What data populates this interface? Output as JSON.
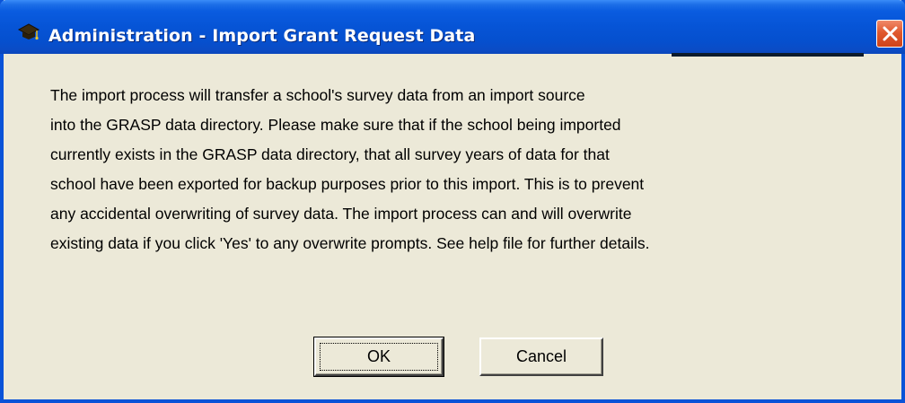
{
  "window": {
    "title": "Administration - Import Grant Request Data",
    "title_icon": "graduation-cap-icon",
    "close_icon": "close-icon",
    "accent_color": "#0a53d8",
    "close_color": "#e0592e"
  },
  "message": {
    "lines": [
      "The import process will transfer a school's survey data from an import source",
      "into the GRASP data directory. Please make sure that if the school being imported",
      "currently exists in the GRASP data directory, that all survey years of data for that",
      "school have been exported for backup purposes prior to this import. This is to prevent",
      "any accidental overwriting of survey data. The import process can and will overwrite",
      "existing data if you click 'Yes' to any overwrite prompts. See help file for further details."
    ]
  },
  "buttons": {
    "ok_label": "OK",
    "cancel_label": "Cancel"
  }
}
